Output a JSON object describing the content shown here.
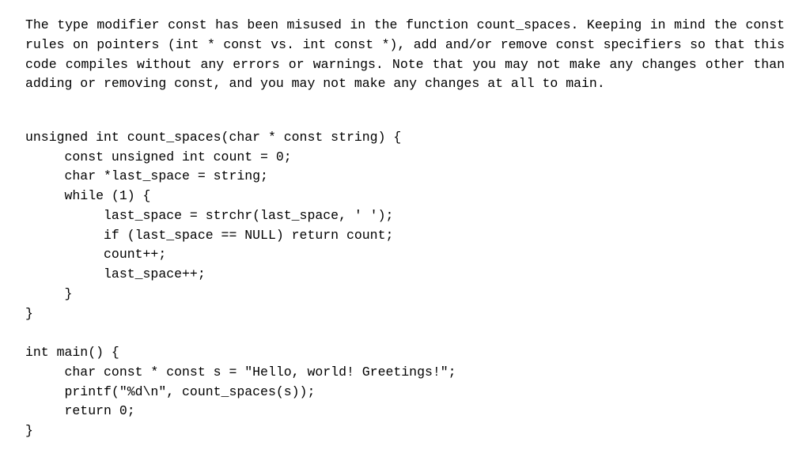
{
  "problem": {
    "paragraph": "The type modifier const has been misused in the function count_spaces. Keeping in mind the const rules on pointers (int * const vs.  int const *), add and/or remove const specifiers so that this code compiles without any errors or warnings.  Note that you may not make any changes other than adding or removing const, and you may not make any changes at all to main."
  },
  "code": {
    "line1": "unsigned int count_spaces(char * const string) {",
    "line2": "     const unsigned int count = 0;",
    "line3": "     char *last_space = string;",
    "line4": "     while (1) {",
    "line5": "          last_space = strchr(last_space, ' ');",
    "line6": "          if (last_space == NULL) return count;",
    "line7": "          count++;",
    "line8": "          last_space++;",
    "line9": "     }",
    "line10": "}",
    "line11": "",
    "line12": "int main() {",
    "line13": "     char const * const s = \"Hello, world! Greetings!\";",
    "line14": "     printf(\"%d\\n\", count_spaces(s));",
    "line15": "     return 0;",
    "line16": "}"
  }
}
